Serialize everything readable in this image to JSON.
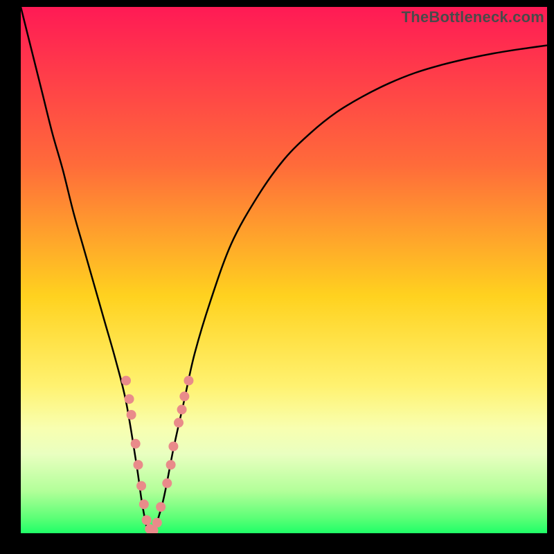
{
  "watermark": "TheBottleneck.com",
  "chart_data": {
    "type": "line",
    "title": "",
    "xlabel": "",
    "ylabel": "",
    "xlim": [
      0,
      100
    ],
    "ylim": [
      0,
      100
    ],
    "grid": false,
    "legend": false,
    "gradient_stops": [
      {
        "offset": 0.0,
        "color": "#ff1a55"
      },
      {
        "offset": 0.3,
        "color": "#ff6b3a"
      },
      {
        "offset": 0.55,
        "color": "#ffd21f"
      },
      {
        "offset": 0.72,
        "color": "#fff270"
      },
      {
        "offset": 0.8,
        "color": "#f8ffb0"
      },
      {
        "offset": 0.85,
        "color": "#e9ffc0"
      },
      {
        "offset": 0.92,
        "color": "#b2ff99"
      },
      {
        "offset": 0.97,
        "color": "#5eff77"
      },
      {
        "offset": 1.0,
        "color": "#1fff67"
      }
    ],
    "series": [
      {
        "name": "curve",
        "color": "#000000",
        "x": [
          0,
          2,
          4,
          6,
          8,
          10,
          12,
          14,
          16,
          18,
          20,
          22,
          23,
          24,
          25,
          27,
          29,
          31,
          33,
          36,
          40,
          45,
          50,
          55,
          60,
          65,
          70,
          75,
          80,
          85,
          90,
          95,
          100
        ],
        "y": [
          100,
          92,
          84,
          76,
          69,
          61,
          54,
          47,
          40,
          33,
          25,
          13,
          6,
          1,
          0,
          6,
          16,
          25,
          34,
          44,
          55,
          64,
          71,
          76,
          80,
          83,
          85.5,
          87.5,
          89,
          90.2,
          91.2,
          92,
          92.7
        ]
      }
    ],
    "markers": {
      "color": "#e98b8a",
      "radius": 7,
      "points": [
        [
          20.0,
          29.0
        ],
        [
          20.6,
          25.5
        ],
        [
          21.0,
          22.5
        ],
        [
          21.8,
          17.0
        ],
        [
          22.3,
          13.0
        ],
        [
          22.9,
          9.0
        ],
        [
          23.4,
          5.5
        ],
        [
          23.9,
          2.5
        ],
        [
          24.5,
          0.8
        ],
        [
          25.2,
          0.5
        ],
        [
          25.9,
          2.0
        ],
        [
          26.6,
          5.0
        ],
        [
          27.8,
          9.5
        ],
        [
          28.5,
          13.0
        ],
        [
          29.0,
          16.5
        ],
        [
          30.0,
          21.0
        ],
        [
          30.6,
          23.5
        ],
        [
          31.1,
          26.0
        ],
        [
          31.9,
          29.0
        ]
      ]
    }
  }
}
